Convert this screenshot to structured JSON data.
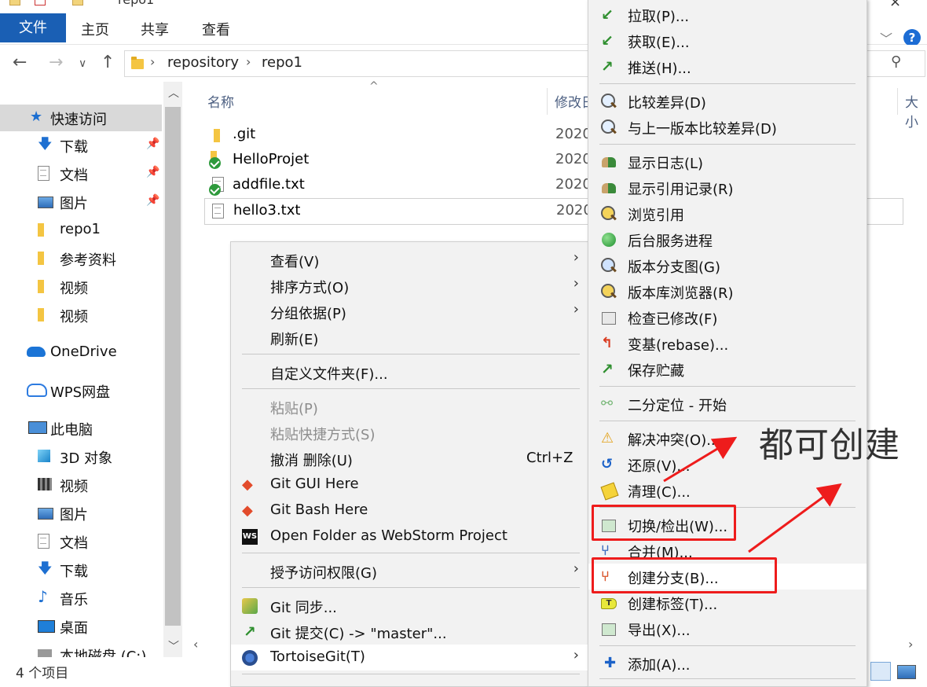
{
  "window": {
    "title": "repo1"
  },
  "ribbon": {
    "tabs": [
      "文件",
      "主页",
      "共享",
      "查看"
    ],
    "help": "?"
  },
  "address": {
    "crumbs": [
      "repository",
      "repo1"
    ],
    "search_icon": "search-icon"
  },
  "navpane": {
    "quick_access": "快速访问",
    "items": [
      {
        "label": "下载",
        "pinned": true
      },
      {
        "label": "文档",
        "pinned": true
      },
      {
        "label": "图片",
        "pinned": true
      },
      {
        "label": "repo1"
      },
      {
        "label": "参考资料"
      },
      {
        "label": "视频"
      },
      {
        "label": "视频"
      }
    ],
    "onedrive": "OneDrive",
    "wps": "WPS网盘",
    "this_pc": "此电脑",
    "pc_items": [
      "3D 对象",
      "视频",
      "图片",
      "文档",
      "下载",
      "音乐",
      "桌面",
      "本地磁盘 (C:)"
    ]
  },
  "filelist": {
    "headers": {
      "name": "名称",
      "modified": "修改日",
      "size": "大小"
    },
    "rows": [
      {
        "name": ".git",
        "date": "2020"
      },
      {
        "name": "HelloProjet",
        "date": "2020"
      },
      {
        "name": "addfile.txt",
        "date": "2020"
      },
      {
        "name": "hello3.txt",
        "date": "2020"
      }
    ]
  },
  "status": {
    "count": "4 个项目"
  },
  "context_menu": {
    "view": "查看(V)",
    "sort": "排序方式(O)",
    "group": "分组依据(P)",
    "refresh": "刷新(E)",
    "customize": "自定义文件夹(F)...",
    "paste": "粘贴(P)",
    "paste_shortcut": "粘贴快捷方式(S)",
    "undo": "撤消 删除(U)",
    "undo_shortcut": "Ctrl+Z",
    "git_gui": "Git GUI Here",
    "git_bash": "Git Bash Here",
    "webstorm": "Open Folder as WebStorm Project",
    "grant": "授予访问权限(G)",
    "git_sync": "Git 同步...",
    "git_commit": "Git 提交(C) -> \"master\"...",
    "tortoise": "TortoiseGit(T)"
  },
  "tortoise_menu": {
    "items": [
      "拉取(P)...",
      "获取(E)...",
      "推送(H)...",
      "比较差异(D)",
      "与上一版本比较差异(D)",
      "显示日志(L)",
      "显示引用记录(R)",
      "浏览引用",
      "后台服务进程",
      "版本分支图(G)",
      "版本库浏览器(R)",
      "检查已修改(F)",
      "变基(rebase)...",
      "保存贮藏",
      "二分定位 - 开始",
      "解决冲突(O)...",
      "还原(V)...",
      "清理(C)...",
      "切换/检出(W)...",
      "合并(M)...",
      "创建分支(B)...",
      "创建标签(T)...",
      "导出(X)...",
      "添加(A)..."
    ]
  },
  "annotation": {
    "text": "都可创建",
    "color": "#ee1c1c"
  }
}
